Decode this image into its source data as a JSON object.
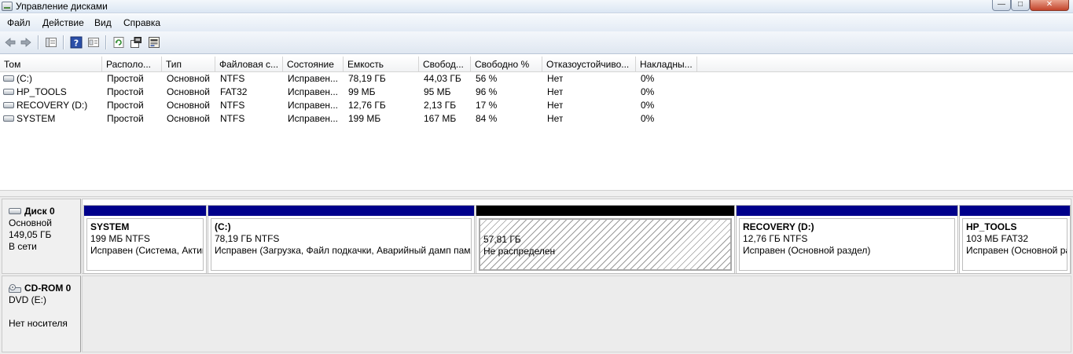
{
  "window": {
    "title": "Управление дисками",
    "close_label": "✕",
    "min_label": "—",
    "max_label": "□"
  },
  "menu": [
    "Файл",
    "Действие",
    "Вид",
    "Справка"
  ],
  "toolbar_icons": [
    "back-arrow-icon",
    "forward-arrow-icon",
    "list-view-icon",
    "help-icon",
    "properties-icon",
    "refresh-icon",
    "settings-icon",
    "disk-wizard-icon"
  ],
  "columns": [
    "Том",
    "Располо...",
    "Тип",
    "Файловая с...",
    "Состояние",
    "Емкость",
    "Свобод...",
    "Свободно %",
    "Отказоустойчиво...",
    "Накладны..."
  ],
  "volumes": [
    [
      "(C:)",
      "Простой",
      "Основной",
      "NTFS",
      "Исправен...",
      "78,19 ГБ",
      "44,03 ГБ",
      "56 %",
      "Нет",
      "0%"
    ],
    [
      "HP_TOOLS",
      "Простой",
      "Основной",
      "FAT32",
      "Исправен...",
      "99 МБ",
      "95 МБ",
      "96 %",
      "Нет",
      "0%"
    ],
    [
      "RECOVERY (D:)",
      "Простой",
      "Основной",
      "NTFS",
      "Исправен...",
      "12,76 ГБ",
      "2,13 ГБ",
      "17 %",
      "Нет",
      "0%"
    ],
    [
      "SYSTEM",
      "Простой",
      "Основной",
      "NTFS",
      "Исправен...",
      "199 МБ",
      "167 МБ",
      "84 %",
      "Нет",
      "0%"
    ]
  ],
  "disk0": {
    "name": "Диск 0",
    "type": "Основной",
    "size": "149,05 ГБ",
    "status": "В сети",
    "partitions": [
      {
        "name": "SYSTEM",
        "size": "199 МБ NTFS",
        "status": "Исправен (Система, Активен, Основной раздел)"
      },
      {
        "name": "(C:)",
        "size": "78,19 ГБ NTFS",
        "status": "Исправен (Загрузка, Файл подкачки, Аварийный дамп памяти, Основной раздел)"
      },
      {
        "name": "",
        "size": "57,81 ГБ",
        "status": "Не распределен"
      },
      {
        "name": "RECOVERY  (D:)",
        "size": "12,76 ГБ NTFS",
        "status": "Исправен (Основной раздел)"
      },
      {
        "name": "HP_TOOLS",
        "size": "103 МБ FAT32",
        "status": "Исправен (Основной раздел)"
      }
    ]
  },
  "cdrom0": {
    "name": "CD-ROM 0",
    "type": "DVD (E:)",
    "status": "Нет носителя"
  }
}
